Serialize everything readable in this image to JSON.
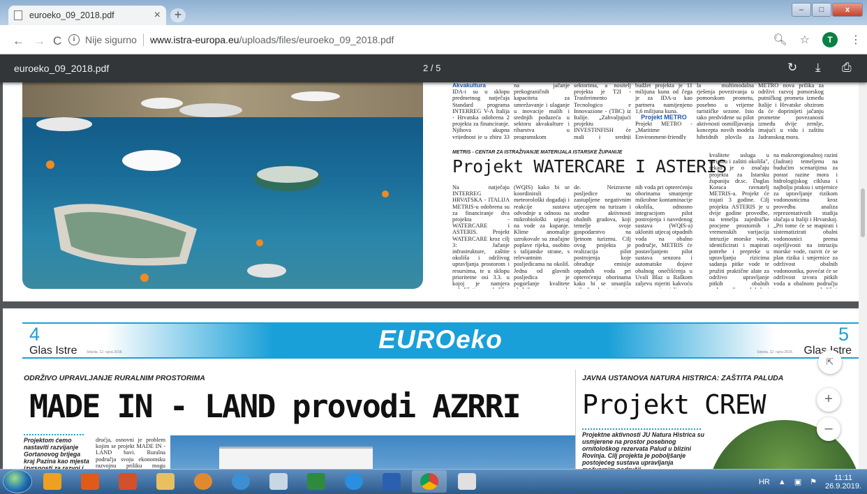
{
  "browser": {
    "tab_title": "euroeko_09_2018.pdf",
    "tab_close": "×",
    "new_tab": "+",
    "security_label": "Nije sigurno",
    "url_domain": "www.istra-europa.eu",
    "url_path": "/uploads/files/euroeko_09_2018.pdf",
    "profile_initial": "T",
    "window_minimize": "–",
    "window_maximize": "□",
    "window_close": "x"
  },
  "pdf_toolbar": {
    "filename": "euroeko_09_2018.pdf",
    "page_indicator": "2 / 5"
  },
  "page1": {
    "section_label": "Akvakultura",
    "col1": "IDA-i su u sklopu predmetnog natječaja Standard programa INTERREG V-A Italija - Hrvatska odobrena 2 projekta za financiranje. Njihova ukupna vrijednost je u zbiru 33 milijuna",
    "col2": "na jačanje prekograničnih kapaciteta za umrežavanje i ulaganje u inovacije malih i srednjih poduzeća u sektoru akvakulture i ribarstva u programskom području. Glavne aktivnosti usmjerene su na istraživanje potreba za naprednim",
    "col3": "sektorima, a nositelj projekta je T2I - Trasferimento Tecnologico e Innovazione - (TBC) iz Italije. „Zahvaljujući projektu INVESTINFISH će mali i srednji poduzetnici te obrtnici s područja Istarske županije koji se bave marikulturom",
    "col4": "budžet projekta je 11 milijuna kuna od čega je za IDA-u kao partnera namijenjeno 1,6 milijuna kuna.",
    "metro_heading": "Projekt METRO",
    "col4b": "Projekt METRO - „Maritime Environment-friendly TRAn-",
    "col5": "la multimodalna rješenja povezivanja u pomorskom prometu, posebno u vrijeme turističke sezone. Isto tako predviđene su pilot aktivnosti osmišljavanja koncepta novih modela hibridnih plovila za prijevoz putnika u",
    "col6": "METRO nova prilika za održivi razvoj pomorskog putničkog prometa između Italije i Hrvatske obzirom da će doprinijeti jačanju prometne povezanosti između dvije zemlje, imajući u vidu i zaštitu Jadranskog mora.",
    "kicker": "METRIS - CENTAR ZA ISTRAŽIVANJE MATERIJALA ISTARSKE ŽUPANIJE",
    "headline": "Projekt WATERCARE I ASTERIS",
    "a1": "Na natječaju INTERREG HRVATSKA - ITALIJA METRIS-u odobrena su za financiranje dva projekta - WATERCARE i ASTERIS. Projekt WATERCARE kroz cilj 3: Jačanje infrastrukture, zaštite okoliša i održivog upravljanja prostorom i resursima, te u sklopu prioritetne osi 3.3. u kojoj je namjera poboljšati okolišne uvjete priobalnih područja održivim i inovativnim tehnologijama i pristupima ima naglasak na razvoju integriranog sustava kvalitete vode",
    "a2": "(WQIS) kako bi se koordinirali meteorološki događaji i reakcije sustava odvodnje u odnosu na mikrobiološki utjecaj na vode za kupanje. Klime anomalije uzrokovale su značajne poplave rijeka, osobito s talijanske strane, s relevantnim posljedicama na okoliš. Jedna od glavnih posljedica je pogoršanje kvalitete obalnih voda fenomenom eutrofikacije, degradacije voda za kupanje fekalnim kontaminacijama koje potječu od lokalnih kanalizacijskih sustava i lokalne poljoprivrede.",
    "a3": "de. Neizravne posljedice su zastupljene negativnim utjecajem na turizam i srodne aktivnosti obalnih gradova, koji temelje svoje gospodarstvo na ljetnom turizmu. Cilj ovog projekta je realizacija pilot postrojenja koje obrađuje emisije otpadnih voda pri opterećenju oborinama kako bi se smanjila mikrobna kontaminacija okoliša. „Osim što će voditi partner iz talijanskog Consiglio Nazionale delle Ricerche - ISMAR osigurati kroz izgradnju pilot postrojenja koje obrađuje emisije otpad-",
    "a4": "nih voda pri opterećenju oborinama smanjenje mikrobne kontaminacije okoliša, odnosno integracijom pilot postrojenja i navedenog sustava (WQIS-a) ukloniti utjecaj otpadnih voda na obalno područje, METRIS će postavljanjem pilot sustava senzora i automatske dojave obalnog onečišćenja u Uvali Blaz u Raškom zaljevu mjeriti kakvoću mora pri izljevanju rijeke Raše, odnosno pravovremeno detektirati vodu koja sadrži štetne tvari doprinijeti sigurnosti i zdravlju ljudi, poboljšanju",
    "a5": "kvalitete usluga u turizmu i zaštiti okoliša\", rekao je o značaju projekta za Istarsku županiju dr.sc. Daglas Koraca ravnatelj METRIS-a. Projekt će trajati 3 godine. Cilj projekta ASTERIS je u dvije godine provedbe, na temelju zajedničke procjene prostornih i vremenskih varijacija intruzije morske vode, identificirati i mapirati potrebe i prepreke u upravljanju rizicima sadanja pitke vode te pružiti praktične alate za održivo upravljanje pitkih obalnih vodonosnika na lokalnoj razini. Sveukupno, projekt bi trebao izrazito doprinijeti rezultatu kartu osjetljivosti na intruziju morske vode u obalnim vodonosnicima",
    "a6": "na makroregionalnoj razini (Jadran) temeljenu na budućim scenarijima za porast razine mora i hidrologijskog ciklusa i najbolju praksu i smjernice za upravljanje rizikom vodonosnicima kroz provedbu analiza reprezentativnih studija slučaja u Italiji i Hrvatskoj. „Pri tome će se mapirati i sistematizirati obalni vodonosnici prema osjetljivosti na intruziju morske vode, razvit će se plan rizika i smjernice za održivost obalnih vodonosnika, povećat će se održivost izvora pitkih voda u obalnom području te naravno poboljšati kvaliteta usluga u turizmu i zaštita okoliša\", dodao je Koraca."
  },
  "page2": {
    "left_page_number": "4",
    "right_page_number": "5",
    "left_paper": "Glas Istre",
    "right_paper": "Glas Istre",
    "left_date": "Srijeda, 12. rujna 2018.",
    "right_date": "Srijeda, 12. rujna 2018.",
    "magazine": "EUROeko",
    "left_section": "ODRŽIVO UPRAVLJANJE RURALNIM PROSTORIMA",
    "left_headline": "MADE IN - LAND provodi AZRRI",
    "left_lead": "Projektom ćemo nastaviti razvijanje Gortanovog brijega kraj Pazina kao mjesta izvrsnosti za razvoj i unaprjeđenje ru-",
    "left_body": "drućja, osnovni je problem kojim se projekt MADE IN - LAND bavi. Ruralna područja svoju ekonomsku razvojnu priliku mogu ostvariti prometnom povezanošću",
    "right_section": "JAVNA USTANOVA NATURA HISTRICA: ZAŠTITA PALUDA",
    "right_headline": "Projekt CREW",
    "right_lead": "Projektne aktivnosti JU Natura Histrica su usmjerene na prostor posebnog ornitološkog rezervata Palud u blizini Rovinja. Cilj projekta je poboljšanje postojećeg sustava upravljanja močvarnim područji-"
  },
  "zoom": {
    "fit": "⇱",
    "plus": "+",
    "minus": "–"
  },
  "taskbar": {
    "language": "HR",
    "time": "11:11",
    "date": "26.9.2019."
  },
  "colors": {
    "accent_blue": "#1aa0d8",
    "pdf_toolbar": "#323639",
    "viewer_bg": "#525659"
  }
}
